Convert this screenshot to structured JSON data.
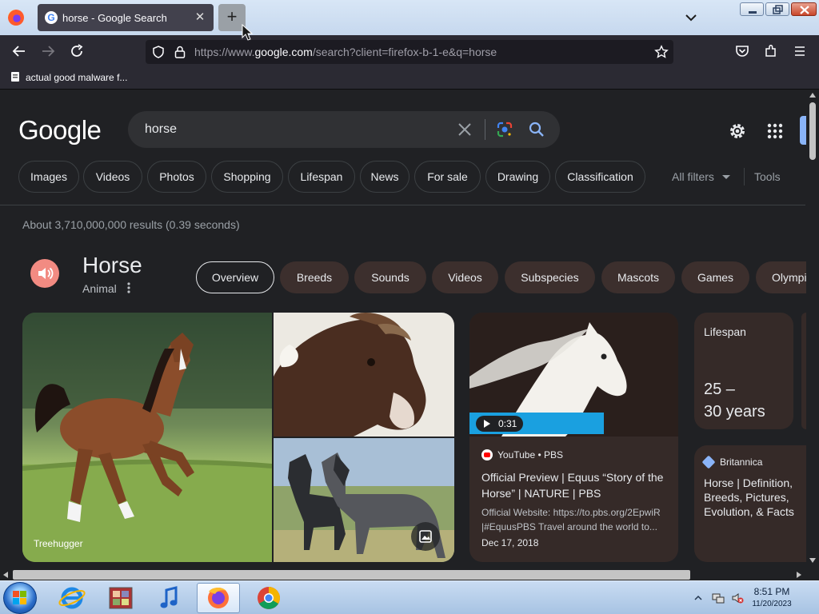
{
  "browser": {
    "tab_title": "horse - Google Search",
    "url_prefix": "https://www.",
    "url_host": "google.com",
    "url_rest": "/search?client=firefox-b-1-e&q=horse",
    "bookmark_label": "actual good malware f..."
  },
  "search": {
    "logo": "Google",
    "query": "horse",
    "filters": [
      "Images",
      "Videos",
      "Photos",
      "Shopping",
      "Lifespan",
      "News",
      "For sale",
      "Drawing",
      "Classification"
    ],
    "all_filters": "All filters",
    "tools": "Tools",
    "stats": "About 3,710,000,000 results (0.39 seconds)"
  },
  "knowledge": {
    "title": "Horse",
    "subtitle": "Animal",
    "pills": [
      "Overview",
      "Breeds",
      "Sounds",
      "Videos",
      "Subspecies",
      "Mascots",
      "Games",
      "Olympi"
    ],
    "active_pill": "Overview",
    "image_caption": "Treehugger",
    "video": {
      "duration": "0:31",
      "source": "YouTube • PBS",
      "title": "Official Preview | Equus “Story of the Horse” | NATURE | PBS",
      "description": "Official Website: https://to.pbs.org/2EpwiR |#EquusPBS Travel around the world to...",
      "date": "Dec 17, 2018"
    },
    "lifespan": {
      "label": "Lifespan",
      "value_line1": "25 –",
      "value_line2": "30 years"
    },
    "britannica": {
      "source": "Britannica",
      "title": "Horse | Definition, Breeds, Pictures, Evolution, & Facts"
    }
  },
  "taskbar": {
    "time": "8:51 PM",
    "date": "11/20/2023"
  },
  "colors": {
    "page_bg": "#202124",
    "card_bg": "#352a28",
    "accent_blue": "#8ab4f8",
    "speak_button": "#f28b82"
  }
}
